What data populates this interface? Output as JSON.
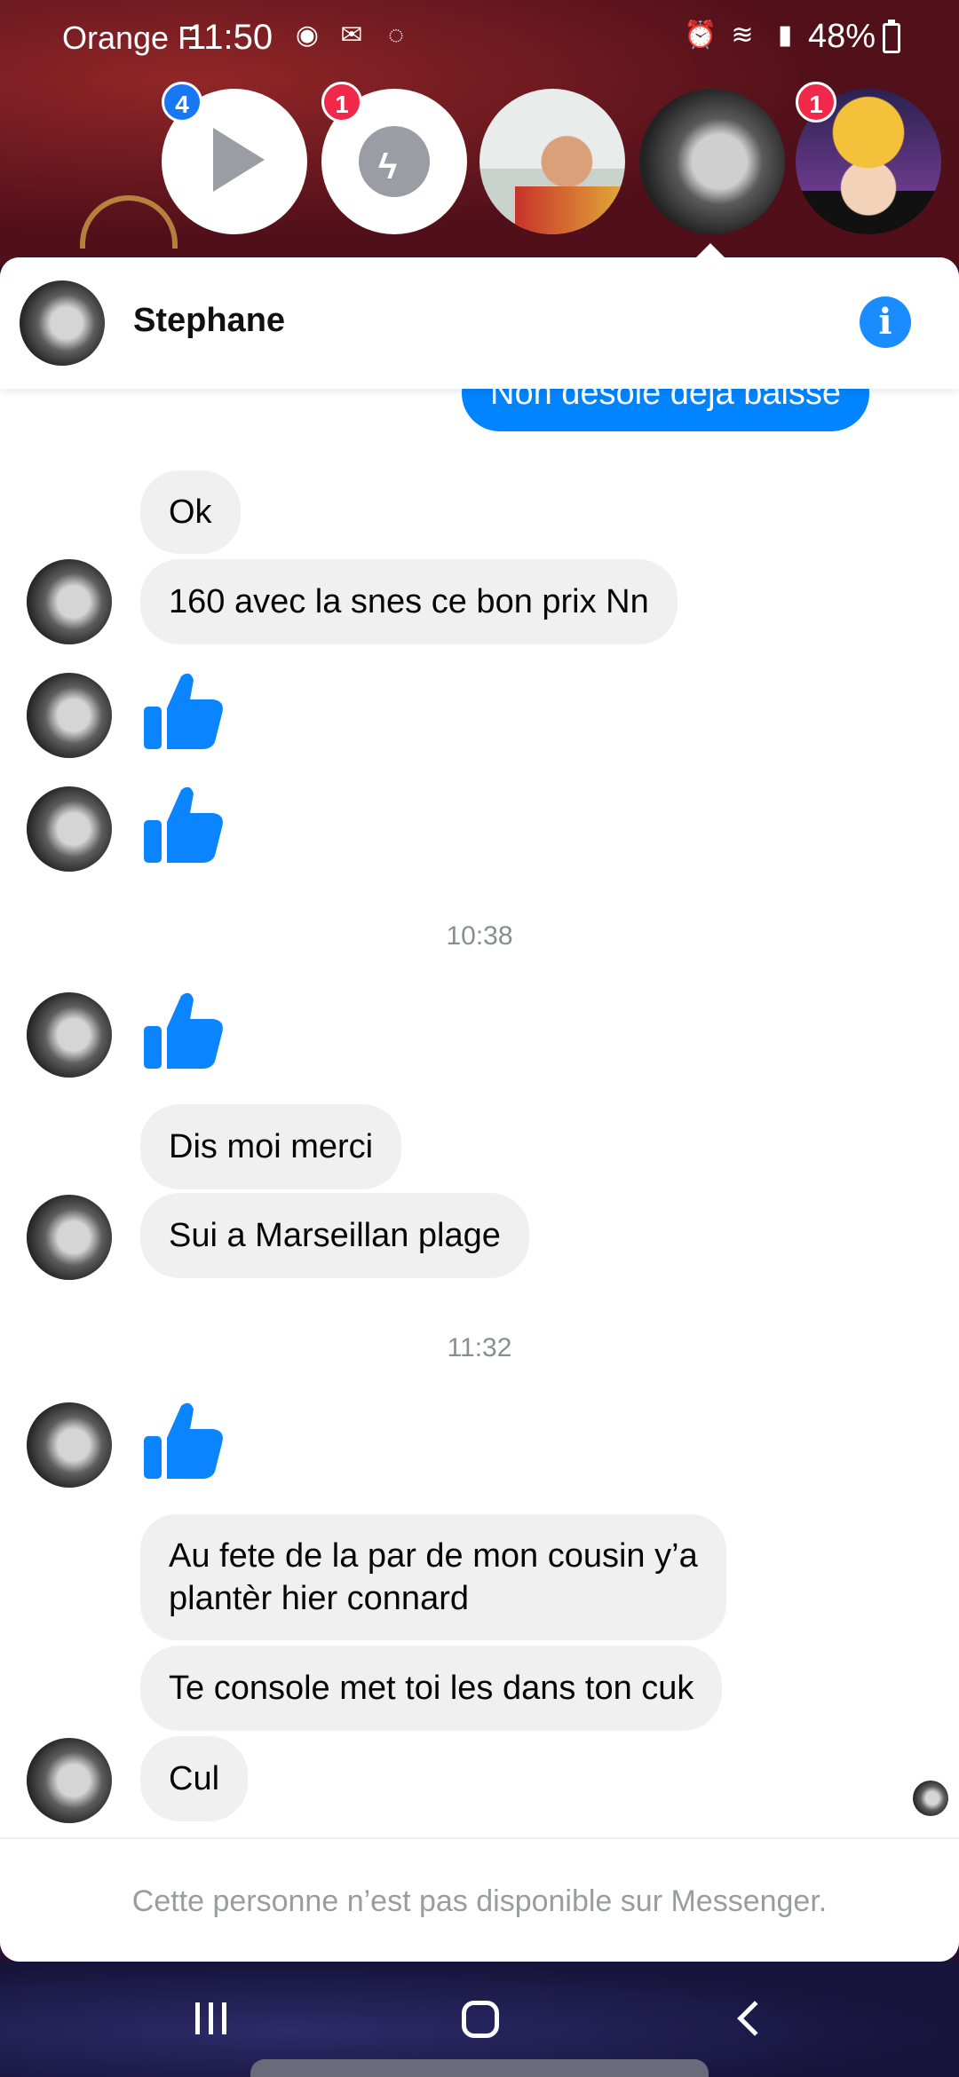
{
  "status_bar": {
    "carrier": "Orange F",
    "time": "11:50",
    "battery": "48%"
  },
  "chat_heads": [
    {
      "name": "video-player-head",
      "badge": "4",
      "badge_color": "#1877f2"
    },
    {
      "name": "messenger-head",
      "badge": "1",
      "badge_color": "#f02849"
    },
    {
      "name": "contact-head-man",
      "badge": null
    },
    {
      "name": "contact-head-stephane",
      "badge": null
    },
    {
      "name": "contact-head-anime",
      "badge": "1",
      "badge_color": "#f02849"
    }
  ],
  "header": {
    "contact_name": "Stephane",
    "info_icon": "i"
  },
  "messages": {
    "m0": "Non desole deja baisse",
    "m1": "Ok",
    "m2": "160 avec la snes ce bon prix Nn",
    "t1": "10:38",
    "m3": "Dis moi merci",
    "m4": "Sui a Marseillan plage",
    "t2": "11:32",
    "m5_line1": "Au fete de la par de mon cousin y’a",
    "m5_line2": "plantèr hier connard",
    "m6": "Te console met toi les dans ton cuk",
    "m7": "Cul"
  },
  "footer": {
    "unavailable_text": "Cette personne n’est pas disponible sur Messenger."
  },
  "colors": {
    "accent": "#0084ff",
    "received_bubble": "#f0f0f0",
    "like_icon": "#0a84ff"
  }
}
